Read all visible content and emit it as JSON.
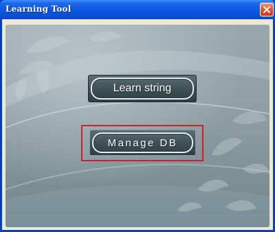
{
  "window": {
    "title": "Learning Tool",
    "close_icon": "close-icon",
    "colors": {
      "titlebar": "#0b55e3",
      "close": "#e2562f",
      "highlight": "#d21d28"
    }
  },
  "buttons": {
    "learn_string": "Learn string",
    "manage_db": "Manage DB"
  }
}
